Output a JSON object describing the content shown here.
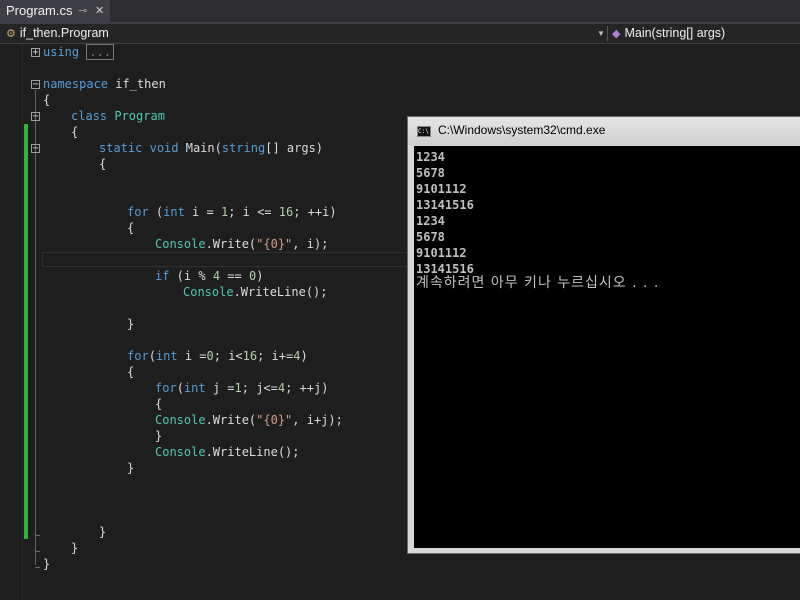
{
  "tab": {
    "label": "Program.cs",
    "pin_icon": "pin-icon",
    "close_icon": "close-icon"
  },
  "nav": {
    "class_path": "if_then.Program",
    "method": "Main(string[] args)"
  },
  "editor": {
    "lines": {
      "l1": [
        "using",
        " ",
        "..."
      ],
      "l3a": "namespace",
      "l3b": " if_then",
      "l4": "{",
      "l5a": "class",
      "l5b": "Program",
      "l6": "{",
      "l7a": "static",
      "l7b": "void",
      "l7c": " Main(",
      "l7d": "string",
      "l7e": "[] args)",
      "l8": "{",
      "l10a": "for",
      "l10b": " (",
      "l10c": "int",
      "l10d": " i = ",
      "l10e": "1",
      "l10f": "; i <= ",
      "l10g": "16",
      "l10h": "; ++i)",
      "l11": "{",
      "l12a": "Console",
      "l12b": ".Write(",
      "l12c": "\"{0}\"",
      "l12d": ", i);",
      "l14a": "if",
      "l14b": " (i % ",
      "l14c": "4",
      "l14d": " == ",
      "l14e": "0",
      "l14f": ")",
      "l15a": "Console",
      "l15b": ".WriteLine();",
      "l17": "}",
      "l19a": "for",
      "l19b": "(",
      "l19c": "int",
      "l19d": " i =",
      "l19e": "0",
      "l19f": "; i<",
      "l19g": "16",
      "l19h": "; i+=",
      "l19i": "4",
      "l19j": ")",
      "l20": "{",
      "l21a": "for",
      "l21b": "(",
      "l21c": "int",
      "l21d": " j =",
      "l21e": "1",
      "l21f": "; j<=",
      "l21g": "4",
      "l21h": "; ++j)",
      "l22": "{",
      "l23a": "Console",
      "l23b": ".Write(",
      "l23c": "\"{0}\"",
      "l23d": ", i+j);",
      "l24": "}",
      "l25a": "Console",
      "l25b": ".WriteLine();",
      "l26": "}",
      "l30": "}",
      "l31": "}",
      "l32": "}"
    }
  },
  "console": {
    "title": "C:\\Windows\\system32\\cmd.exe",
    "output": [
      "1234",
      "5678",
      "9101112",
      "13141516",
      "1234",
      "5678",
      "9101112",
      "13141516"
    ],
    "prompt": "계속하려면 아무 키나 누르십시오 . . ."
  }
}
